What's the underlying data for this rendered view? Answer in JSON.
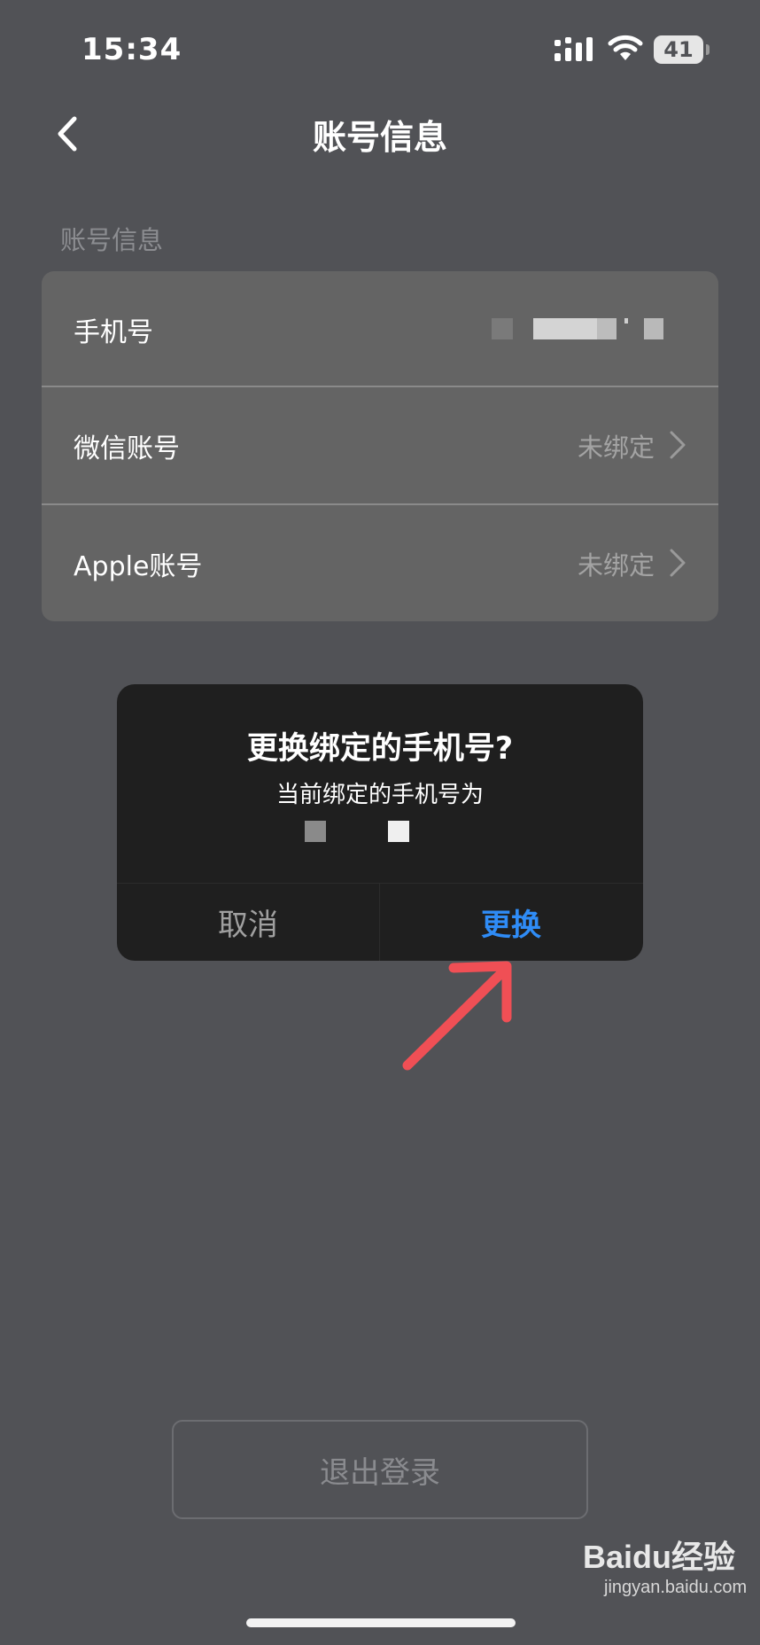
{
  "status_bar": {
    "time": "15:34",
    "battery": "41"
  },
  "nav": {
    "title": "账号信息"
  },
  "section": {
    "label": "账号信息"
  },
  "rows": [
    {
      "label": "手机号",
      "value": ""
    },
    {
      "label": "微信账号",
      "value": "未绑定"
    },
    {
      "label": "Apple账号",
      "value": "未绑定"
    }
  ],
  "dialog": {
    "title": "更换绑定的手机号?",
    "message": "当前绑定的手机号为",
    "cancel": "取消",
    "confirm": "更换"
  },
  "logout": {
    "label": "退出登录"
  },
  "watermark": {
    "brand": "Baidu经验",
    "url": "jingyan.baidu.com"
  },
  "colors": {
    "accent": "#2f8cf6",
    "annotation_arrow": "#f04f55"
  }
}
